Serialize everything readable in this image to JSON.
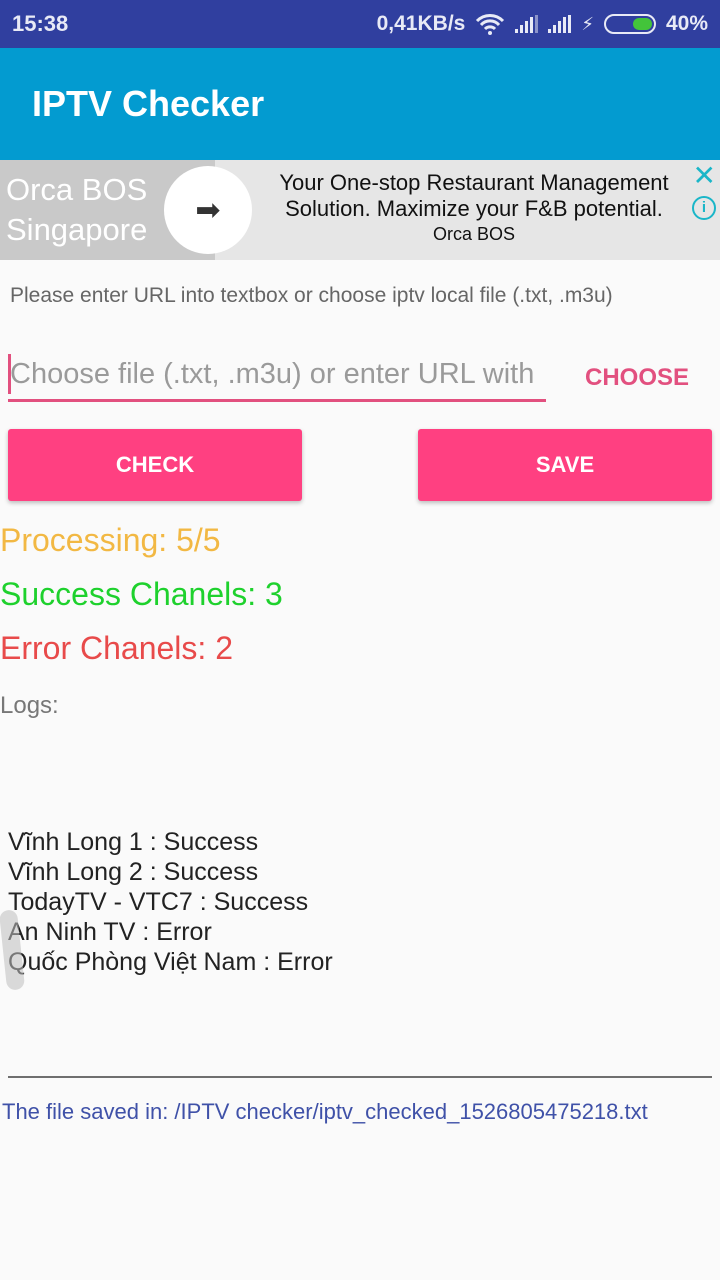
{
  "status_bar": {
    "time": "15:38",
    "network_speed": "0,41KB/s",
    "icons": [
      "wifi-icon",
      "signal-icon",
      "signal-icon",
      "charging-icon",
      "battery-icon"
    ],
    "battery_level": 0.4,
    "battery_text": "40%",
    "battery_color": "#43c43a"
  },
  "app_bar": {
    "title": "IPTV Checker",
    "color": "#039bd0"
  },
  "ad": {
    "brand_line1": "Orca BOS",
    "brand_line2": "Singapore",
    "arrow_icon": "➡",
    "headline": "Your One-stop Restaurant Management Solution. Maximize your F&B potential.",
    "advertiser": "Orca BOS",
    "close_icon": "✕",
    "info_icon": "i"
  },
  "main": {
    "instruction": "Please enter URL into textbox or choose iptv local file (.txt, .m3u)",
    "url_input": {
      "value": "",
      "placeholder": "Choose file (.txt, .m3u) or enter URL with"
    },
    "choose_label": "CHOOSE",
    "check_label": "CHECK",
    "save_label": "SAVE",
    "accent_color": "#ff4081"
  },
  "stats": {
    "processing": "Processing: 5/5",
    "success": "Success Chanels: 3",
    "error": "Error Chanels: 2",
    "colors": {
      "processing": "#f2b843",
      "success": "#1ed12d",
      "error": "#e84a4a"
    }
  },
  "logs": {
    "label": "Logs:",
    "lines": [
      "Vĩnh Long 1 : Success",
      "Vĩnh Long 2 : Success",
      "TodayTV - VTC7 : Success",
      "An Ninh TV : Error",
      "Quốc Phòng Việt Nam : Error"
    ]
  },
  "footer": {
    "saved_path": "The file saved in: /IPTV checker/iptv_checked_1526805475218.txt"
  }
}
